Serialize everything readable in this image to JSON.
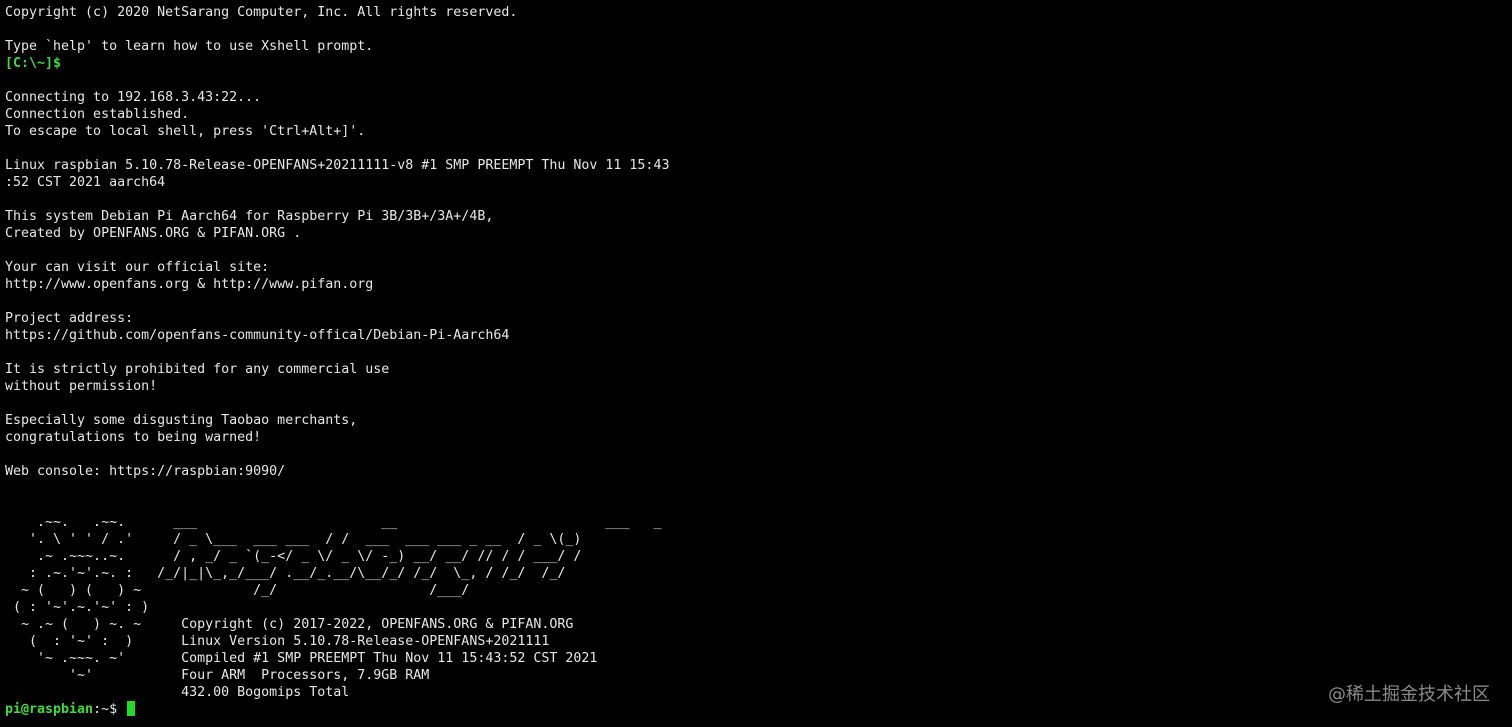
{
  "terminal": {
    "lines": [
      "Copyright (c) 2020 NetSarang Computer, Inc. All rights reserved.",
      "",
      "Type `help' to learn how to use Xshell prompt.",
      "",
      "",
      "Connecting to 192.168.3.43:22...",
      "Connection established.",
      "To escape to local shell, press 'Ctrl+Alt+]'.",
      "",
      "Linux raspbian 5.10.78-Release-OPENFANS+20211111-v8 #1 SMP PREEMPT Thu Nov 11 15:43",
      ":52 CST 2021 aarch64",
      "",
      "This system Debian Pi Aarch64 for Raspberry Pi 3B/3B+/3A+/4B,",
      "Created by OPENFANS.ORG & PIFAN.ORG .",
      "",
      "Your can visit our official site:",
      "http://www.openfans.org & http://www.pifan.org",
      "",
      "Project address:",
      "https://github.com/openfans-community-offical/Debian-Pi-Aarch64",
      "",
      "It is strictly prohibited for any commercial use",
      "without permission!",
      "",
      "Especially some disgusting Taobao merchants,",
      "congratulations to being warned!",
      "",
      "Web console: https://raspbian:9090/",
      "",
      "",
      "    .~~.   .~~.      ___                       __                          ___   _",
      "   '. \\ ' ' / .'     / _ \\___  ___ ___  / /  ___  ___ ___ _ __  / _ \\(_)",
      "    .~ .~~~..~.      / , _/ _ `(_-</ _ \\/ _ \\/ -_) __/ __/ // / / ___/ /",
      "   : .~.'~'.~. :   /_/|_|\\_,_/___/ .__/_.__/\\__/_/ /_/  \\_, / /_/  /_/",
      "  ~ (   ) (   ) ~              /_/                   /___/",
      " ( : '~'.~.'~' : )",
      "  ~ .~ (   ) ~. ~     Copyright (c) 2017-2022, OPENFANS.ORG & PIFAN.ORG",
      "   (  : '~' :  )      Linux Version 5.10.78-Release-OPENFANS+2021111",
      "    '~ .~~~. ~'       Compiled #1 SMP PREEMPT Thu Nov 11 15:43:52 CST 2021",
      "        '~'           Four ARM  Processors, 7.9GB RAM",
      "                      432.00 Bogomips Total"
    ],
    "local_prompt": "[C:\\~]$",
    "remote_prompt_user": "pi@raspbian",
    "remote_prompt_rest": ":~$"
  },
  "watermark": "@稀土掘金技术社区",
  "colors": {
    "background": "#000000",
    "text": "#e8e8e8",
    "prompt_green": "#38e038",
    "cursor": "#22dd22"
  }
}
